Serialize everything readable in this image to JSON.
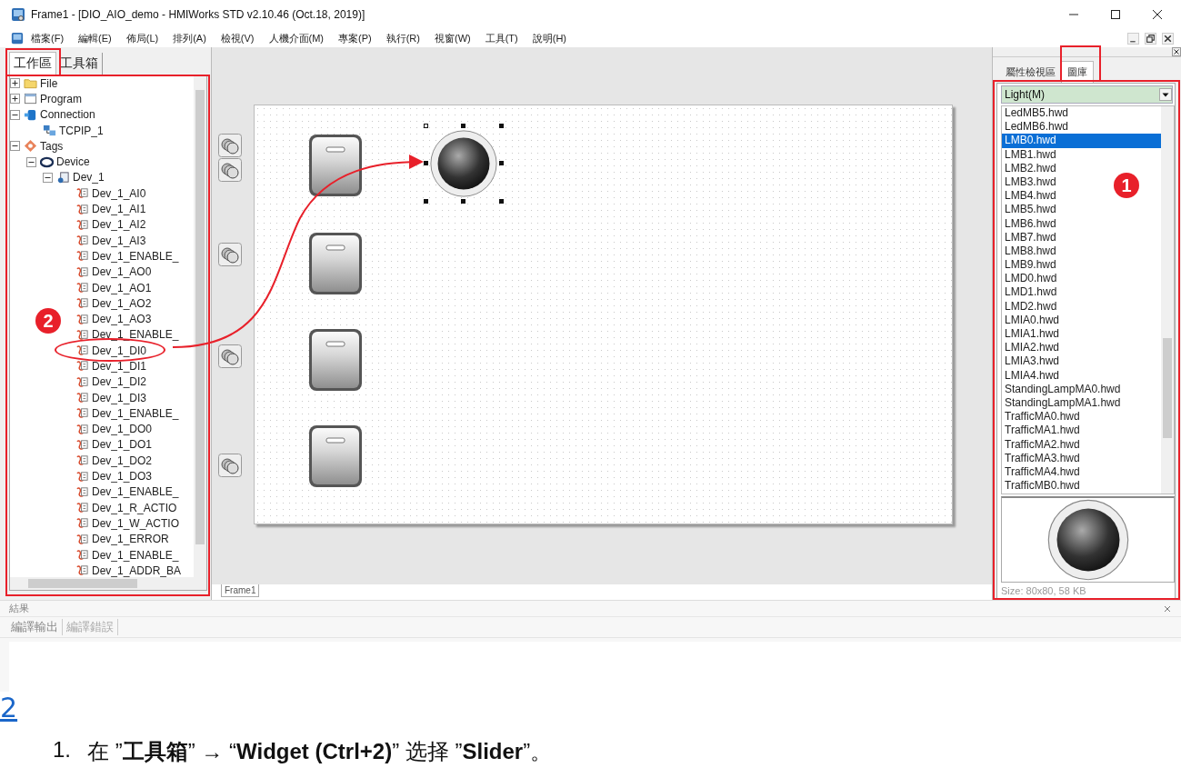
{
  "window": {
    "title": "Frame1 - [DIO_AIO_demo - HMIWorks STD v2.10.46 (Oct.18, 2019)]"
  },
  "menu": [
    "檔案(F)",
    "編輯(E)",
    "佈局(L)",
    "排列(A)",
    "檢視(V)",
    "人機介面(M)",
    "專案(P)",
    "執行(R)",
    "視窗(W)",
    "工具(T)",
    "說明(H)"
  ],
  "left_panel": {
    "tabs": [
      {
        "label": "工作區",
        "selected": true
      },
      {
        "label": "工具箱",
        "selected": false
      }
    ],
    "tree": [
      {
        "label": "File",
        "kind": "folder",
        "expanded": false
      },
      {
        "label": "Program",
        "kind": "program",
        "expanded": false
      },
      {
        "label": "Connection",
        "kind": "connection",
        "expanded": true,
        "children": [
          {
            "label": "TCPIP_1",
            "kind": "link"
          }
        ]
      },
      {
        "label": "Tags",
        "kind": "tags",
        "expanded": true,
        "children": [
          {
            "label": "Device",
            "kind": "device",
            "expanded": true,
            "children": [
              {
                "label": "Dev_1",
                "kind": "module",
                "expanded": true,
                "children": [
                  {
                    "label": "Dev_1_AI0",
                    "kind": "tag"
                  },
                  {
                    "label": "Dev_1_AI1",
                    "kind": "tag"
                  },
                  {
                    "label": "Dev_1_AI2",
                    "kind": "tag"
                  },
                  {
                    "label": "Dev_1_AI3",
                    "kind": "tag"
                  },
                  {
                    "label": "Dev_1_ENABLE_",
                    "kind": "tag"
                  },
                  {
                    "label": "Dev_1_AO0",
                    "kind": "tag"
                  },
                  {
                    "label": "Dev_1_AO1",
                    "kind": "tag"
                  },
                  {
                    "label": "Dev_1_AO2",
                    "kind": "tag"
                  },
                  {
                    "label": "Dev_1_AO3",
                    "kind": "tag"
                  },
                  {
                    "label": "Dev_1_ENABLE_",
                    "kind": "tag"
                  },
                  {
                    "label": "Dev_1_DI0",
                    "kind": "tag",
                    "circled": true
                  },
                  {
                    "label": "Dev_1_DI1",
                    "kind": "tag"
                  },
                  {
                    "label": "Dev_1_DI2",
                    "kind": "tag"
                  },
                  {
                    "label": "Dev_1_DI3",
                    "kind": "tag"
                  },
                  {
                    "label": "Dev_1_ENABLE_",
                    "kind": "tag"
                  },
                  {
                    "label": "Dev_1_DO0",
                    "kind": "tag"
                  },
                  {
                    "label": "Dev_1_DO1",
                    "kind": "tag"
                  },
                  {
                    "label": "Dev_1_DO2",
                    "kind": "tag"
                  },
                  {
                    "label": "Dev_1_DO3",
                    "kind": "tag"
                  },
                  {
                    "label": "Dev_1_ENABLE_",
                    "kind": "tag"
                  },
                  {
                    "label": "Dev_1_R_ACTIO",
                    "kind": "tag"
                  },
                  {
                    "label": "Dev_1_W_ACTIO",
                    "kind": "tag"
                  },
                  {
                    "label": "Dev_1_ERROR",
                    "kind": "tag"
                  },
                  {
                    "label": "Dev_1_ENABLE_",
                    "kind": "tag"
                  },
                  {
                    "label": "Dev_1_ADDR_BA",
                    "kind": "tag"
                  }
                ]
              }
            ]
          }
        ]
      }
    ]
  },
  "canvas": {
    "switches": [
      {
        "on": false
      },
      {
        "on": false
      },
      {
        "on": false
      },
      {
        "on": false
      }
    ]
  },
  "document_tabs": [
    "Frame1"
  ],
  "right_panel": {
    "tabs": [
      {
        "label": "屬性檢視區",
        "selected": false
      },
      {
        "label": "圖庫",
        "selected": true
      }
    ],
    "category": "Light(M)",
    "files": [
      {
        "name": "LedMB5.hwd",
        "selected": false
      },
      {
        "name": "LedMB6.hwd",
        "selected": false
      },
      {
        "name": "LMB0.hwd",
        "selected": true
      },
      {
        "name": "LMB1.hwd",
        "selected": false
      },
      {
        "name": "LMB2.hwd",
        "selected": false
      },
      {
        "name": "LMB3.hwd",
        "selected": false
      },
      {
        "name": "LMB4.hwd",
        "selected": false
      },
      {
        "name": "LMB5.hwd",
        "selected": false
      },
      {
        "name": "LMB6.hwd",
        "selected": false
      },
      {
        "name": "LMB7.hwd",
        "selected": false
      },
      {
        "name": "LMB8.hwd",
        "selected": false
      },
      {
        "name": "LMB9.hwd",
        "selected": false
      },
      {
        "name": "LMD0.hwd",
        "selected": false
      },
      {
        "name": "LMD1.hwd",
        "selected": false
      },
      {
        "name": "LMD2.hwd",
        "selected": false
      },
      {
        "name": "LMIA0.hwd",
        "selected": false
      },
      {
        "name": "LMIA1.hwd",
        "selected": false
      },
      {
        "name": "LMIA2.hwd",
        "selected": false
      },
      {
        "name": "LMIA3.hwd",
        "selected": false
      },
      {
        "name": "LMIA4.hwd",
        "selected": false
      },
      {
        "name": "StandingLampMA0.hwd",
        "selected": false
      },
      {
        "name": "StandingLampMA1.hwd",
        "selected": false
      },
      {
        "name": "TrafficMA0.hwd",
        "selected": false
      },
      {
        "name": "TrafficMA1.hwd",
        "selected": false
      },
      {
        "name": "TrafficMA2.hwd",
        "selected": false
      },
      {
        "name": "TrafficMA3.hwd",
        "selected": false
      },
      {
        "name": "TrafficMA4.hwd",
        "selected": false
      },
      {
        "name": "TrafficMB0.hwd",
        "selected": false
      }
    ],
    "preview_info": "Size: 80x80, 58 KB"
  },
  "results": {
    "title": "結果",
    "tabs": [
      {
        "label": "編譯輸出",
        "selected": true
      },
      {
        "label": "編譯錯誤",
        "selected": false
      }
    ]
  },
  "annotations": [
    "1",
    "2"
  ],
  "document": {
    "link": "2",
    "step_number": "1.",
    "step_text": "在 ”**工具箱**” **→** “**Widget (Ctrl+2)**” 选择 ”**Slider**”。"
  }
}
